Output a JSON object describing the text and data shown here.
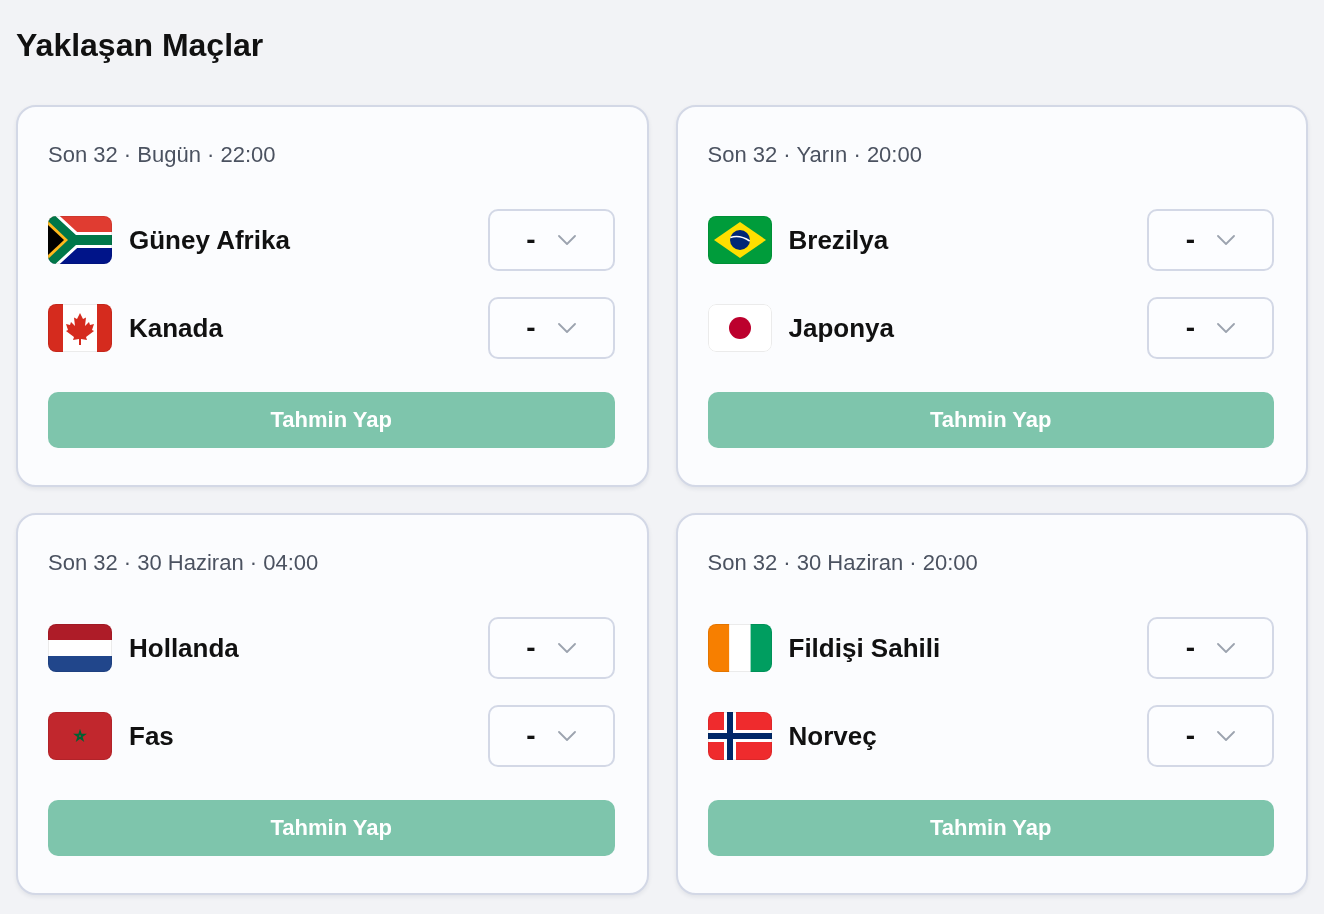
{
  "title": "Yaklaşan Maçlar",
  "matches": [
    {
      "meta": "Son 32 · Bugün · 22:00",
      "teams": [
        {
          "name": "Güney Afrika",
          "kind": "za",
          "score": "-"
        },
        {
          "name": "Kanada",
          "kind": "ca",
          "score": "-"
        }
      ],
      "button": {
        "label": "Tahmin Yap",
        "disabled": true
      }
    },
    {
      "meta": "Son 32 · Yarın · 20:00",
      "teams": [
        {
          "name": "Brezilya",
          "kind": "br",
          "score": "-"
        },
        {
          "name": "Japonya",
          "kind": "jp",
          "score": "-"
        }
      ],
      "button": {
        "label": "Tahmin Yap",
        "disabled": true
      }
    },
    {
      "meta": "Son 32 · 30 Haziran · 04:00",
      "teams": [
        {
          "name": "Hollanda",
          "kind": "nl",
          "score": "-"
        },
        {
          "name": "Fas",
          "kind": "ma",
          "score": "-"
        }
      ],
      "button": {
        "label": "Tahmin Yap",
        "disabled": true
      }
    },
    {
      "meta": "Son 32 · 30 Haziran · 20:00",
      "teams": [
        {
          "name": "Fildişi Sahili",
          "kind": "ci",
          "score": "-"
        },
        {
          "name": "Norveç",
          "kind": "no",
          "score": "-"
        }
      ],
      "button": {
        "label": "Tahmin Yap",
        "disabled": true
      }
    }
  ]
}
